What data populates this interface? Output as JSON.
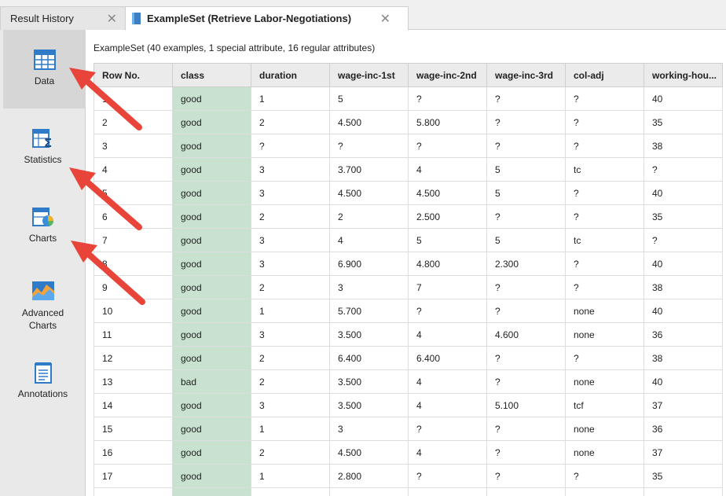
{
  "tabs": [
    {
      "label": "Result History"
    },
    {
      "label": "ExampleSet (Retrieve Labor-Negotiations)"
    }
  ],
  "close_glyph": "✕",
  "sidebar": {
    "items": [
      {
        "label": "Data",
        "icon": "data-table-icon"
      },
      {
        "label": "Statistics",
        "icon": "statistics-icon"
      },
      {
        "label": "Charts",
        "icon": "charts-icon"
      },
      {
        "label": "Advanced Charts",
        "icon": "advanced-charts-icon"
      },
      {
        "label": "Annotations",
        "icon": "annotations-icon"
      }
    ]
  },
  "summary": "ExampleSet (40 examples, 1 special attribute, 16 regular attributes)",
  "table": {
    "columns": [
      "Row No.",
      "class",
      "duration",
      "wage-inc-1st",
      "wage-inc-2nd",
      "wage-inc-3rd",
      "col-adj",
      "working-hou..."
    ],
    "rows": [
      [
        "1",
        "good",
        "1",
        "5",
        "?",
        "?",
        "?",
        "40"
      ],
      [
        "2",
        "good",
        "2",
        "4.500",
        "5.800",
        "?",
        "?",
        "35"
      ],
      [
        "3",
        "good",
        "?",
        "?",
        "?",
        "?",
        "?",
        "38"
      ],
      [
        "4",
        "good",
        "3",
        "3.700",
        "4",
        "5",
        "tc",
        "?"
      ],
      [
        "5",
        "good",
        "3",
        "4.500",
        "4.500",
        "5",
        "?",
        "40"
      ],
      [
        "6",
        "good",
        "2",
        "2",
        "2.500",
        "?",
        "?",
        "35"
      ],
      [
        "7",
        "good",
        "3",
        "4",
        "5",
        "5",
        "tc",
        "?"
      ],
      [
        "8",
        "good",
        "3",
        "6.900",
        "4.800",
        "2.300",
        "?",
        "40"
      ],
      [
        "9",
        "good",
        "2",
        "3",
        "7",
        "?",
        "?",
        "38"
      ],
      [
        "10",
        "good",
        "1",
        "5.700",
        "?",
        "?",
        "none",
        "40"
      ],
      [
        "11",
        "good",
        "3",
        "3.500",
        "4",
        "4.600",
        "none",
        "36"
      ],
      [
        "12",
        "good",
        "2",
        "6.400",
        "6.400",
        "?",
        "?",
        "38"
      ],
      [
        "13",
        "bad",
        "2",
        "3.500",
        "4",
        "?",
        "none",
        "40"
      ],
      [
        "14",
        "good",
        "3",
        "3.500",
        "4",
        "5.100",
        "tcf",
        "37"
      ],
      [
        "15",
        "good",
        "1",
        "3",
        "?",
        "?",
        "none",
        "36"
      ],
      [
        "16",
        "good",
        "2",
        "4.500",
        "4",
        "?",
        "none",
        "37"
      ],
      [
        "17",
        "good",
        "1",
        "2.800",
        "?",
        "?",
        "?",
        "35"
      ],
      [
        "",
        "",
        "",
        "",
        "",
        "",
        "",
        ""
      ]
    ]
  },
  "colors": {
    "special_column": "#c8e2cf",
    "annotation_arrow": "#e8443a"
  }
}
